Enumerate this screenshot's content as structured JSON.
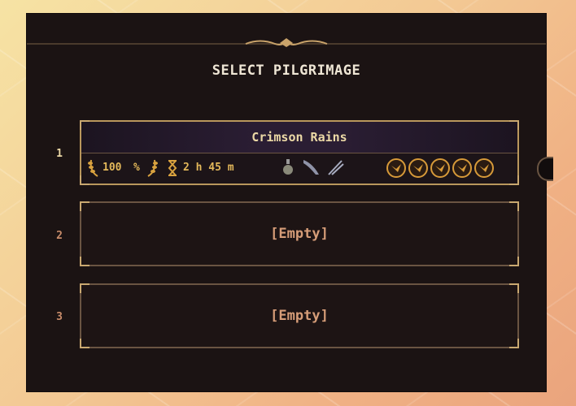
{
  "screen": {
    "title": "SELECT PILGRIMAGE"
  },
  "slots": [
    {
      "number": "1",
      "name": "Crimson Rains",
      "completion": "100",
      "completion_unit": "%",
      "playtime": "2 h 45 m",
      "weapon_icons": [
        "flask-icon",
        "blade-icon",
        "spear-icon"
      ],
      "medal_icons": [
        "eagle-medal-icon",
        "eagle-medal-icon",
        "eagle-medal-icon",
        "eagle-medal-icon",
        "eagle-medal-icon"
      ]
    },
    {
      "number": "2",
      "label": "[Empty]"
    },
    {
      "number": "3",
      "label": "[Empty]"
    }
  ],
  "colors": {
    "accent_gold": "#e3b85a",
    "slot_number_active": "#ecd9a6",
    "slot_number_inactive": "#c98c6a",
    "empty_text": "#d69d78",
    "panel_bg": "#1b1313"
  }
}
